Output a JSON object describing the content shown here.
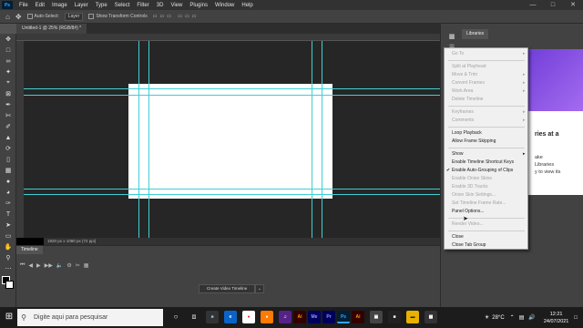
{
  "menubar": {
    "app_logo": "Ps",
    "items": [
      "File",
      "Edit",
      "Image",
      "Layer",
      "Type",
      "Select",
      "Filter",
      "3D",
      "View",
      "Plugins",
      "Window",
      "Help"
    ],
    "window_controls": [
      "minimize-icon",
      "maximize-icon",
      "close-icon"
    ]
  },
  "options_bar": {
    "auto_select_label": "Auto-Select:",
    "auto_select_target": "Layer",
    "transform_controls_label": "Show Transform Controls"
  },
  "document": {
    "tab_title": "Untitled-1 @ 25% (RGB/8#) *",
    "status": "1920 px x 1080 px (72 ppi)"
  },
  "timeline": {
    "tab_label": "Timeline",
    "create_button_label": "Create Video Timeline"
  },
  "libraries": {
    "tab_label": "Libraries",
    "card_heading": "ries at a",
    "card_text_line1": "ake",
    "card_text_line2": "Libraries",
    "card_text_line3": "y to view its"
  },
  "context_menu": {
    "items": [
      {
        "label": "Go To",
        "disabled": true,
        "submenu": true
      },
      {
        "separator": true
      },
      {
        "label": "Split at Playhead",
        "disabled": true
      },
      {
        "label": "Move & Trim",
        "disabled": true,
        "submenu": true
      },
      {
        "label": "Convert Frames",
        "disabled": true,
        "submenu": true
      },
      {
        "label": "Work Area",
        "disabled": true,
        "submenu": true
      },
      {
        "label": "Delete Timeline",
        "disabled": true
      },
      {
        "separator": true
      },
      {
        "label": "Keyframes",
        "disabled": true,
        "submenu": true
      },
      {
        "label": "Comments",
        "disabled": true,
        "submenu": true
      },
      {
        "separator": true
      },
      {
        "label": "Loop Playback",
        "disabled": false
      },
      {
        "label": "Allow Frame Skipping",
        "disabled": false
      },
      {
        "separator": true
      },
      {
        "label": "Show",
        "disabled": false,
        "submenu": true
      },
      {
        "label": "Enable Timeline Shortcut Keys",
        "disabled": false
      },
      {
        "label": "Enable Auto-Grouping of Clips",
        "disabled": false,
        "checked": true
      },
      {
        "label": "Enable Onion Skins",
        "disabled": true
      },
      {
        "label": "Enable 3D Tracks",
        "disabled": true
      },
      {
        "label": "Onion Skin Settings...",
        "disabled": true
      },
      {
        "label": "Set Timeline Frame Rate...",
        "disabled": true
      },
      {
        "label": "Panel Options...",
        "disabled": false
      },
      {
        "separator": true
      },
      {
        "label": "Render Video...",
        "disabled": true
      },
      {
        "separator": true
      },
      {
        "label": "Close",
        "disabled": false
      },
      {
        "label": "Close Tab Group",
        "disabled": false
      }
    ]
  },
  "taskbar": {
    "search_placeholder": "Digite aqui para pesquisar",
    "weather": "28°C",
    "time": "12:21",
    "date": "24/07/2021",
    "apps": [
      "Ai",
      "Me",
      "Pr",
      "Ps",
      "Ai"
    ]
  },
  "colors": {
    "guide": "#3fd0d4",
    "workspace": "#262626",
    "panel": "#424242",
    "menu_bg": "#f0f0f0",
    "libraries_accent": "#7b45e0"
  }
}
